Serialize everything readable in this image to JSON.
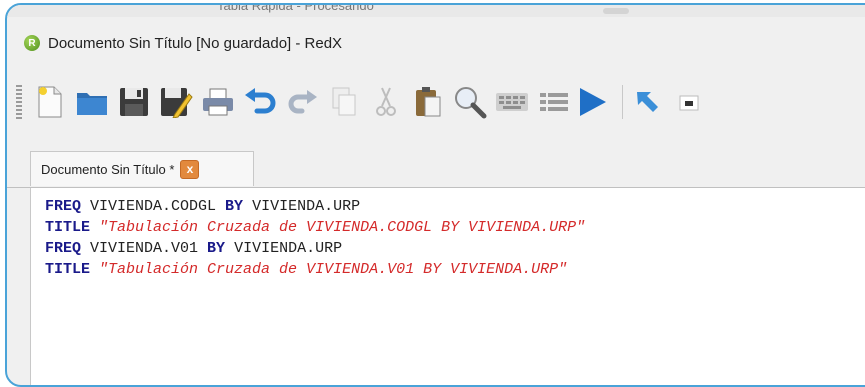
{
  "background_window": {
    "title": "Tabla Rápida - Procesando"
  },
  "window": {
    "title": "Documento Sin Título [No guardado] - RedX"
  },
  "toolbar": {
    "buttons": [
      {
        "icon": "new-document-icon"
      },
      {
        "icon": "open-folder-icon"
      },
      {
        "icon": "save-icon"
      },
      {
        "icon": "save-as-icon"
      },
      {
        "icon": "print-icon"
      },
      {
        "icon": "undo-icon"
      },
      {
        "icon": "redo-icon"
      },
      {
        "icon": "copy-icon"
      },
      {
        "icon": "cut-icon"
      },
      {
        "icon": "paste-icon"
      },
      {
        "icon": "find-icon"
      },
      {
        "icon": "keyboard-icon"
      },
      {
        "icon": "list-icon"
      },
      {
        "icon": "run-icon"
      },
      {
        "icon": "cursor-arrow-icon"
      },
      {
        "icon": "output-window-icon"
      }
    ]
  },
  "tabs": [
    {
      "label": "Documento Sin Título *",
      "close": "x"
    }
  ],
  "editor": {
    "lines": [
      [
        {
          "t": "kw",
          "v": "FREQ"
        },
        {
          "t": "id",
          "v": " VIVIENDA.CODGL "
        },
        {
          "t": "kw",
          "v": "BY"
        },
        {
          "t": "id",
          "v": " VIVIENDA.URP"
        }
      ],
      [
        {
          "t": "kw",
          "v": "TITLE"
        },
        {
          "t": "id",
          "v": " "
        },
        {
          "t": "str",
          "v": "\"Tabulación Cruzada de VIVIENDA.CODGL BY VIVIENDA.URP\""
        }
      ],
      [
        {
          "t": "kw",
          "v": "FREQ"
        },
        {
          "t": "id",
          "v": " VIVIENDA.V01 "
        },
        {
          "t": "kw",
          "v": "BY"
        },
        {
          "t": "id",
          "v": " VIVIENDA.URP"
        }
      ],
      [
        {
          "t": "kw",
          "v": "TITLE"
        },
        {
          "t": "id",
          "v": " "
        },
        {
          "t": "str",
          "v": "\"Tabulación Cruzada de VIVIENDA.V01 BY VIVIENDA.URP\""
        }
      ]
    ]
  },
  "colors": {
    "frame": "#4aa3d8",
    "keyword": "#1a1a8a",
    "string": "#d42a2a",
    "close_button": "#e2893d"
  }
}
